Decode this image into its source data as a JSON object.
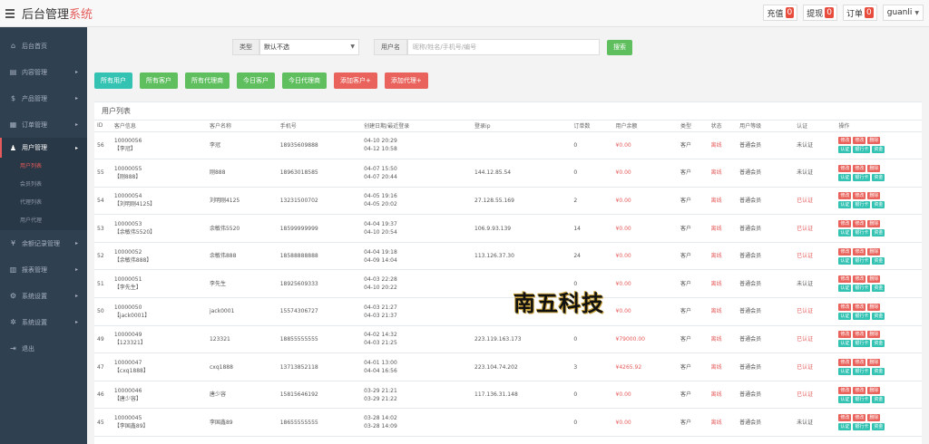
{
  "header": {
    "brand_main": "后台管理",
    "brand_accent": "系统",
    "recharge_label": "充值",
    "recharge_count": "0",
    "withdraw_label": "提现",
    "withdraw_count": "0",
    "orders_label": "订单",
    "orders_count": "0",
    "username": "guanli"
  },
  "sidebar": {
    "items": [
      {
        "label": "后台首页",
        "icon": "home-icon"
      },
      {
        "label": "内容管理",
        "icon": "book-icon"
      },
      {
        "label": "产品管理",
        "icon": "dollar-icon"
      },
      {
        "label": "订单管理",
        "icon": "clipboard-icon"
      },
      {
        "label": "用户管理",
        "icon": "user-icon"
      },
      {
        "label": "余额记录管理",
        "icon": "yen-icon"
      },
      {
        "label": "报表管理",
        "icon": "chart-icon"
      },
      {
        "label": "系统设置",
        "icon": "gear-icon"
      },
      {
        "label": "系统设置",
        "icon": "gears-icon"
      },
      {
        "label": "退出",
        "icon": "logout-icon"
      }
    ],
    "user_sub": [
      "用户列表",
      "会员列表",
      "代理列表",
      "用户代理"
    ]
  },
  "search": {
    "type_label": "类型",
    "type_value": "默认不选",
    "user_label": "用户名",
    "user_placeholder": "昵称/姓名/手机号/编号",
    "search_button": "搜索"
  },
  "filters": [
    {
      "label": "所有用户",
      "style": "teal"
    },
    {
      "label": "所有客户",
      "style": "green"
    },
    {
      "label": "所有代理商",
      "style": "green"
    },
    {
      "label": "今日客户",
      "style": "green"
    },
    {
      "label": "今日代理商",
      "style": "green"
    },
    {
      "label": "添加客户+",
      "style": "red"
    },
    {
      "label": "添加代理+",
      "style": "red"
    }
  ],
  "panel_title": "用户列表",
  "table": {
    "headers": [
      "ID",
      "客户信息",
      "客户名称",
      "手机号",
      "创建日期/最近登录",
      "登录ip",
      "订单数",
      "用户余额",
      "类型",
      "状态",
      "用户等级",
      "认证",
      "操作"
    ],
    "rows": [
      {
        "id": "56",
        "code": "10000056",
        "nick": "【李冠】",
        "name": "李冠",
        "phone": "18935609888",
        "created": "04-10 20:29",
        "login": "04-12 10:58",
        "ip": "",
        "orders": "0",
        "balance": "¥0.00",
        "type": "客户",
        "status": "离线",
        "level": "普通会员",
        "auth": "未认证"
      },
      {
        "id": "55",
        "code": "10000055",
        "nick": "【刚888】",
        "name": "刚888",
        "phone": "18963018585",
        "created": "04-07 15:50",
        "login": "04-07 20:44",
        "ip": "144.12.85.54",
        "orders": "0",
        "balance": "¥0.00",
        "type": "客户",
        "status": "离线",
        "level": "普通会员",
        "auth": "未认证"
      },
      {
        "id": "54",
        "code": "10000054",
        "nick": "【刘明刚4125】",
        "name": "刘明刚4125",
        "phone": "13231500702",
        "created": "04-05 19:16",
        "login": "04-05 20:02",
        "ip": "27.128.55.169",
        "orders": "2",
        "balance": "¥0.00",
        "type": "客户",
        "status": "离线",
        "level": "普通会员",
        "auth": "已认证"
      },
      {
        "id": "53",
        "code": "10000053",
        "nick": "【余敏伟5520】",
        "name": "余敏伟5520",
        "phone": "18599999999",
        "created": "04-04 19:37",
        "login": "04-10 20:54",
        "ip": "106.9.93.139",
        "orders": "14",
        "balance": "¥0.00",
        "type": "客户",
        "status": "离线",
        "level": "普通会员",
        "auth": "已认证"
      },
      {
        "id": "52",
        "code": "10000052",
        "nick": "【余敏伟888】",
        "name": "余敏伟888",
        "phone": "18588888888",
        "created": "04-04 19:18",
        "login": "04-09 14:04",
        "ip": "113.126.37.30",
        "orders": "24",
        "balance": "¥0.00",
        "type": "客户",
        "status": "离线",
        "level": "普通会员",
        "auth": "已认证"
      },
      {
        "id": "51",
        "code": "10000051",
        "nick": "【李先生】",
        "name": "李先生",
        "phone": "18925609333",
        "created": "04-03 22:28",
        "login": "04-10 20:22",
        "ip": "",
        "orders": "0",
        "balance": "¥0.00",
        "type": "客户",
        "status": "离线",
        "level": "普通会员",
        "auth": "未认证"
      },
      {
        "id": "50",
        "code": "10000050",
        "nick": "【jack0001】",
        "name": "jack0001",
        "phone": "15574306727",
        "created": "04-03 21:27",
        "login": "04-03 21:37",
        "ip": "",
        "orders": "0",
        "balance": "¥0.00",
        "type": "客户",
        "status": "离线",
        "level": "普通会员",
        "auth": "已认证"
      },
      {
        "id": "49",
        "code": "10000049",
        "nick": "【123321】",
        "name": "123321",
        "phone": "18855555555",
        "created": "04-02 14:32",
        "login": "04-03 21:25",
        "ip": "223.119.163.173",
        "orders": "0",
        "balance": "¥79000.00",
        "type": "客户",
        "status": "离线",
        "level": "普通会员",
        "auth": "已认证"
      },
      {
        "id": "47",
        "code": "10000047",
        "nick": "【cxq1888】",
        "name": "cxq1888",
        "phone": "13713852118",
        "created": "04-01 13:00",
        "login": "04-04 16:56",
        "ip": "223.104.74.202",
        "orders": "3",
        "balance": "¥4265.92",
        "type": "客户",
        "status": "离线",
        "level": "普通会员",
        "auth": "已认证"
      },
      {
        "id": "46",
        "code": "10000046",
        "nick": "【唐少容】",
        "name": "唐少容",
        "phone": "15815646192",
        "created": "03-29 21:21",
        "login": "03-29 21:22",
        "ip": "117.136.31.148",
        "orders": "0",
        "balance": "¥0.00",
        "type": "客户",
        "status": "离线",
        "level": "普通会员",
        "auth": "已认证"
      },
      {
        "id": "45",
        "code": "10000045",
        "nick": "【李国鑫89】",
        "name": "李国鑫89",
        "phone": "18655555555",
        "created": "03-28 14:02",
        "login": "03-28 14:09",
        "ip": "",
        "orders": "0",
        "balance": "¥0.00",
        "type": "客户",
        "status": "离线",
        "level": "普通会员",
        "auth": "未认证"
      }
    ],
    "ops": [
      {
        "label": "修改",
        "style": "r"
      },
      {
        "label": "修改",
        "style": "r"
      },
      {
        "label": "删除",
        "style": "r"
      },
      {
        "label": "认证",
        "style": "t"
      },
      {
        "label": "银行卡",
        "style": "t"
      },
      {
        "label": "资金",
        "style": "t"
      }
    ]
  },
  "watermark": "南五科技"
}
